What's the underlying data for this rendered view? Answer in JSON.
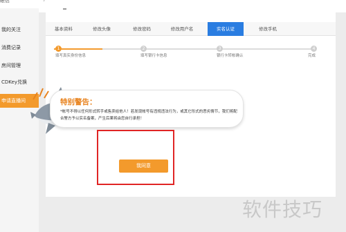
{
  "top": {
    "breadcrumb": "帐信",
    "fragment": "~ ˜ ≈ ¸ ≈ ¸"
  },
  "sidebar": {
    "items": [
      {
        "label": "我的关注"
      },
      {
        "label": "消费记录"
      },
      {
        "label": "房间管理"
      },
      {
        "label": "CDKey兑换"
      },
      {
        "label": "申请直播间"
      }
    ]
  },
  "tabs": [
    {
      "label": "基本资料"
    },
    {
      "label": "修改头像"
    },
    {
      "label": "修改密码"
    },
    {
      "label": "修改用户名"
    },
    {
      "label": "实名认证"
    },
    {
      "label": "修改手机"
    }
  ],
  "steps": [
    {
      "num": "1",
      "label": "填写真实身份信息"
    },
    {
      "num": "2",
      "label": "填写银行卡信息"
    },
    {
      "num": "3",
      "label": "银行卡转帐确认"
    },
    {
      "num": "4",
      "label": "完成"
    }
  ],
  "warning": {
    "title": "特别警告：",
    "text": "*帐号不得以任何形式转手或售卖给他人！若发现帐号有违规违法行为，或其它形式的恶劣情节，我们将配合警方予以实名备案，产生后果将由您自行承担！"
  },
  "agree_label": "我同意",
  "watermark": "软件技巧",
  "colors": {
    "accent": "#f39a2c",
    "tab_active": "#2a7de1",
    "highlight": "#e02424"
  }
}
